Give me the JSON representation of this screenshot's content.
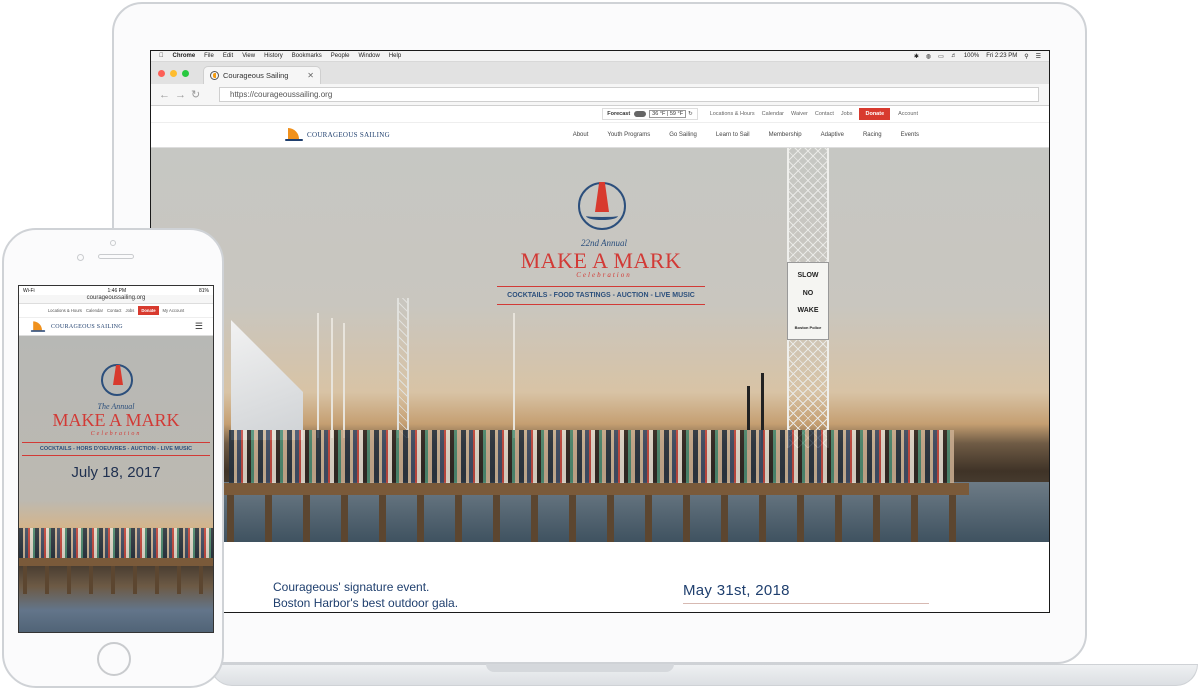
{
  "mac_menubar": {
    "items": [
      "Chrome",
      "File",
      "Edit",
      "View",
      "History",
      "Bookmarks",
      "People",
      "Window",
      "Help"
    ],
    "battery": "100%",
    "clock": "Fri 2:23 PM"
  },
  "browser": {
    "tab_title": "Courageous Sailing",
    "url": "https://courageoussailing.org"
  },
  "site": {
    "forecast_label": "Forecast",
    "forecast_temp": "36 °F | 59 °F",
    "util_links": [
      "Locations & Hours",
      "Calendar",
      "Waiver",
      "Contact",
      "Jobs"
    ],
    "donate": "Donate",
    "account": "Account",
    "logo_text": "COURAGEOUS SAILING",
    "nav": [
      "About",
      "Youth Programs",
      "Go Sailing",
      "Learn to Sail",
      "Membership",
      "Adaptive",
      "Racing",
      "Events"
    ],
    "hero": {
      "annual": "22nd Annual",
      "title": "MAKE A MARK",
      "celebration": "Celebration",
      "tagline": "COCKTAILS - FOOD TASTINGS - AUCTION - LIVE MUSIC",
      "sign": [
        "SLOW",
        "NO",
        "WAKE",
        "Boston Police"
      ]
    },
    "intro_line1": "Courageous' signature event.",
    "intro_line2": "Boston Harbor's best outdoor gala.",
    "event_date": "May 31st, 2018"
  },
  "phone": {
    "carrier": "Wi-Fi",
    "time": "1:46 PM",
    "battery": "81%",
    "url": "courageoussailing.org",
    "util_links": [
      "Locations & Hours",
      "Calendar",
      "Contact",
      "Jobs"
    ],
    "donate": "Donate",
    "account": "My Account",
    "logo_text": "COURAGEOUS SAILING",
    "hero": {
      "annual": "The Annual",
      "title": "MAKE A MARK",
      "celebration": "Celebration",
      "tagline": "COCKTAILS - HORS D'OEUVRES - AUCTION - LIVE MUSIC",
      "date": "July 18, 2017"
    }
  }
}
